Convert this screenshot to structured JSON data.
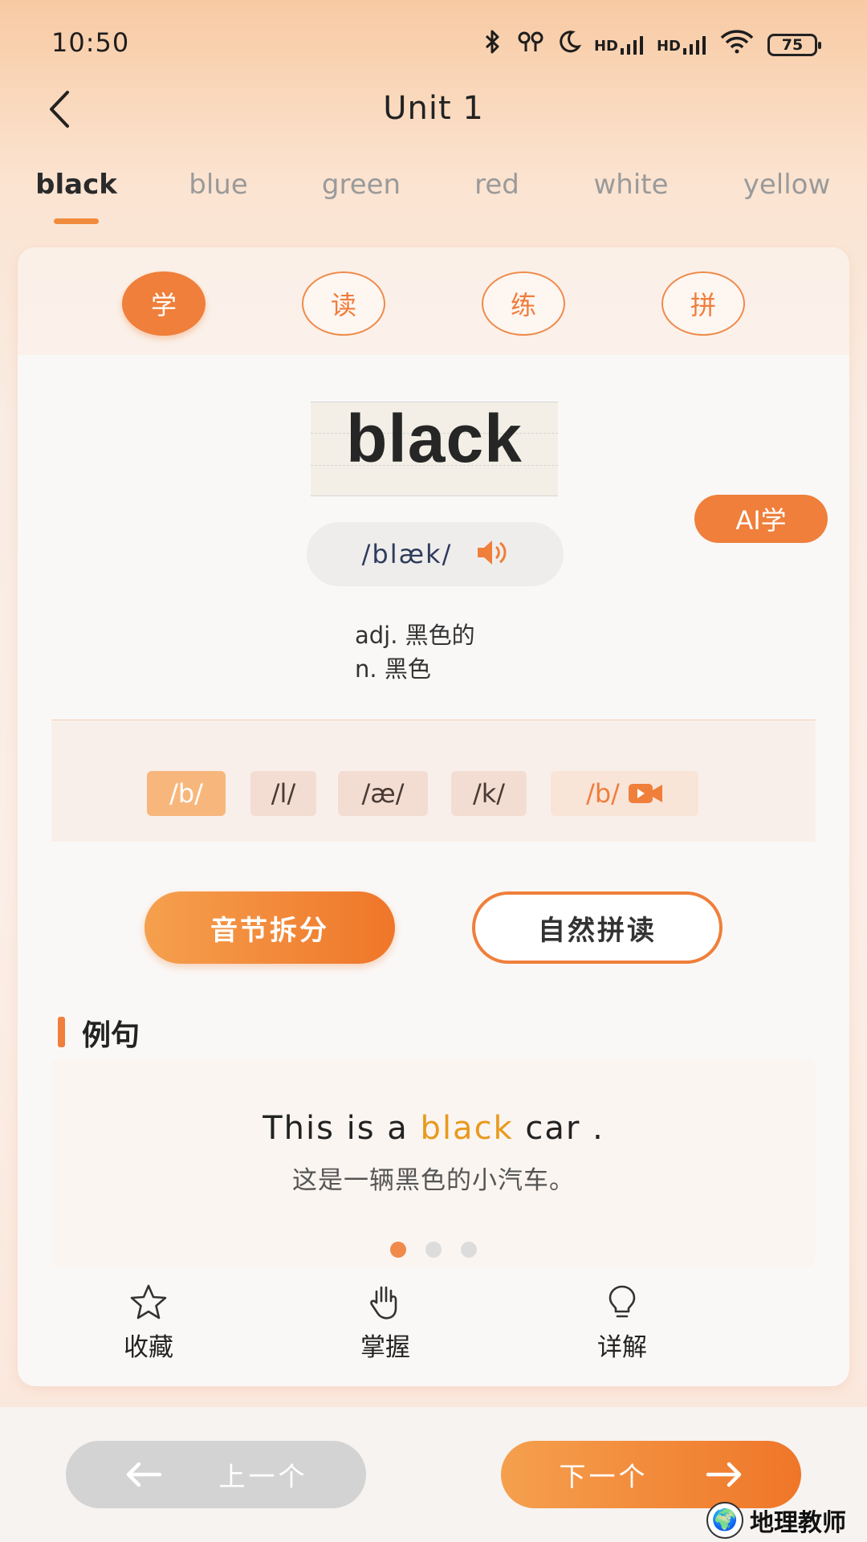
{
  "status_bar": {
    "time": "10:50",
    "battery": "75",
    "net1": "HD",
    "net2": "HD"
  },
  "header": {
    "title": "Unit 1"
  },
  "word_tabs": [
    {
      "label": "black",
      "active": true
    },
    {
      "label": "blue"
    },
    {
      "label": "green"
    },
    {
      "label": "red"
    },
    {
      "label": "white"
    },
    {
      "label": "yellow"
    }
  ],
  "modes": [
    {
      "label": "学",
      "active": true
    },
    {
      "label": "读"
    },
    {
      "label": "练"
    },
    {
      "label": "拼"
    }
  ],
  "word": {
    "text": "black",
    "phonetic": "/blæk/",
    "meanings": [
      "adj. 黑色的",
      "n. 黑色"
    ]
  },
  "ai_button": "AI学",
  "phonemes": [
    "/b/",
    "/l/",
    "/æ/",
    "/k/"
  ],
  "phoneme_video": "/b/",
  "buttons": {
    "syllable_split": "音节拆分",
    "natural_phonics": "自然拼读"
  },
  "example": {
    "section_title": "例句",
    "sentence_before": "This is a ",
    "sentence_highlight": "black",
    "sentence_after": " car .",
    "translation": "这是一辆黑色的小汽车。",
    "page_count": 3,
    "active_page": 1
  },
  "actions": {
    "favorite": "收藏",
    "master": "掌握",
    "detail": "详解"
  },
  "nav": {
    "prev": "上一个",
    "next": "下一个"
  },
  "watermark": "地理教师",
  "colors": {
    "accent": "#ef7f3a",
    "highlight": "#e89a1e",
    "disabled": "#d3d3d3"
  }
}
